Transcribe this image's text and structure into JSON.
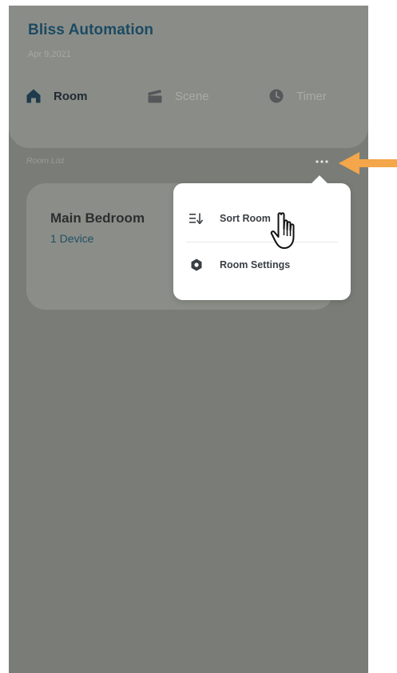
{
  "app": {
    "title": "Bliss Automation",
    "date": "Apr 9,2021"
  },
  "tabs": [
    {
      "label": "Room",
      "icon": "home-icon",
      "active": true
    },
    {
      "label": "Scene",
      "icon": "clapperboard-icon",
      "active": false
    },
    {
      "label": "Timer",
      "icon": "clock-icon",
      "active": false
    }
  ],
  "room_list": {
    "section_label": "Room List",
    "more_icon": "more-dots-icon",
    "rooms": [
      {
        "name": "Main Bedroom",
        "devices": "1 Device"
      }
    ]
  },
  "popup_menu": {
    "items": [
      {
        "label": "Sort Room",
        "icon": "sort-icon"
      },
      {
        "label": "Room Settings",
        "icon": "hexagon-settings-icon"
      }
    ]
  },
  "colors": {
    "brand_title": "#1c4a63",
    "device_count": "#1f4f63",
    "overlay_bg": "#7a7d77",
    "annotation_arrow": "#f4a64a"
  }
}
